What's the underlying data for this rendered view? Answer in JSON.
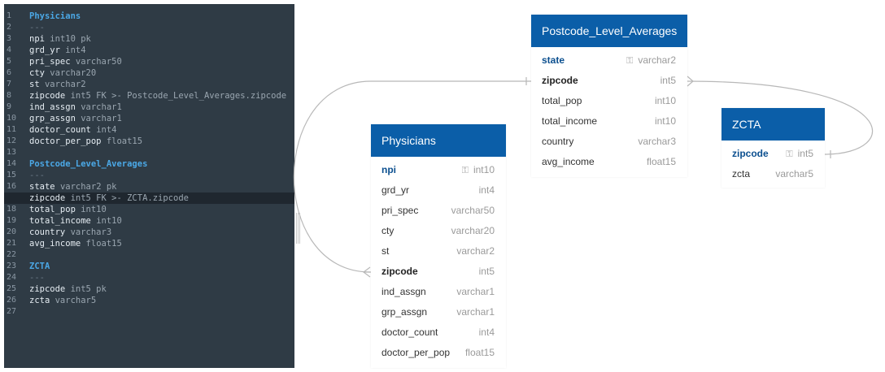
{
  "editor": {
    "lines": [
      {
        "n": "1",
        "parts": [
          {
            "t": "Physicians",
            "c": "tname"
          }
        ]
      },
      {
        "n": "2",
        "parts": [
          {
            "t": "---",
            "c": "sep"
          }
        ]
      },
      {
        "n": "3",
        "parts": [
          {
            "t": "npi ",
            "c": "col"
          },
          {
            "t": "int10 pk",
            "c": "meta"
          }
        ]
      },
      {
        "n": "4",
        "parts": [
          {
            "t": "grd_yr ",
            "c": "col"
          },
          {
            "t": "int4",
            "c": "meta"
          }
        ]
      },
      {
        "n": "5",
        "parts": [
          {
            "t": "pri_spec ",
            "c": "col"
          },
          {
            "t": "varchar50",
            "c": "meta"
          }
        ]
      },
      {
        "n": "6",
        "parts": [
          {
            "t": "cty ",
            "c": "col"
          },
          {
            "t": "varchar20",
            "c": "meta"
          }
        ]
      },
      {
        "n": "7",
        "parts": [
          {
            "t": "st ",
            "c": "col"
          },
          {
            "t": "varchar2",
            "c": "meta"
          }
        ]
      },
      {
        "n": "8",
        "parts": [
          {
            "t": "zipcode ",
            "c": "col"
          },
          {
            "t": "int5 FK >- Postcode_Level_Averages.zipcode",
            "c": "meta"
          }
        ]
      },
      {
        "n": "9",
        "parts": [
          {
            "t": "ind_assgn ",
            "c": "col"
          },
          {
            "t": "varchar1",
            "c": "meta"
          }
        ]
      },
      {
        "n": "10",
        "parts": [
          {
            "t": "grp_assgn ",
            "c": "col"
          },
          {
            "t": "varchar1",
            "c": "meta"
          }
        ]
      },
      {
        "n": "11",
        "parts": [
          {
            "t": "doctor_count ",
            "c": "col"
          },
          {
            "t": "int4",
            "c": "meta"
          }
        ]
      },
      {
        "n": "12",
        "parts": [
          {
            "t": "doctor_per_pop ",
            "c": "col"
          },
          {
            "t": "float15",
            "c": "meta"
          }
        ]
      },
      {
        "n": "13",
        "parts": []
      },
      {
        "n": "14",
        "parts": [
          {
            "t": "Postcode_Level_Averages",
            "c": "tname"
          }
        ]
      },
      {
        "n": "15",
        "parts": [
          {
            "t": "---",
            "c": "sep"
          }
        ]
      },
      {
        "n": "16",
        "parts": [
          {
            "t": "state ",
            "c": "col"
          },
          {
            "t": "varchar2 pk",
            "c": "meta"
          }
        ]
      },
      {
        "n": "17",
        "active": true,
        "parts": [
          {
            "t": "zipcode ",
            "c": "col"
          },
          {
            "t": "int5 FK >- ZCTA.zipcode",
            "c": "meta"
          }
        ]
      },
      {
        "n": "18",
        "parts": [
          {
            "t": "total_pop ",
            "c": "col"
          },
          {
            "t": "int10",
            "c": "meta"
          }
        ]
      },
      {
        "n": "19",
        "parts": [
          {
            "t": "total_income ",
            "c": "col"
          },
          {
            "t": "int10",
            "c": "meta"
          }
        ]
      },
      {
        "n": "20",
        "parts": [
          {
            "t": "country ",
            "c": "col"
          },
          {
            "t": "varchar3",
            "c": "meta"
          }
        ]
      },
      {
        "n": "21",
        "parts": [
          {
            "t": "avg_income ",
            "c": "col"
          },
          {
            "t": "float15",
            "c": "meta"
          }
        ]
      },
      {
        "n": "22",
        "parts": []
      },
      {
        "n": "23",
        "parts": [
          {
            "t": "ZCTA",
            "c": "tname"
          }
        ]
      },
      {
        "n": "24",
        "parts": [
          {
            "t": "---",
            "c": "sep"
          }
        ]
      },
      {
        "n": "25",
        "parts": [
          {
            "t": "zipcode ",
            "c": "col"
          },
          {
            "t": "int5 pk",
            "c": "meta"
          }
        ]
      },
      {
        "n": "26",
        "parts": [
          {
            "t": "zcta ",
            "c": "col"
          },
          {
            "t": "varchar5",
            "c": "meta"
          }
        ]
      },
      {
        "n": "27",
        "parts": []
      }
    ]
  },
  "diagram": {
    "colors": {
      "header_bg": "#0b5ea8",
      "header_text": "#ffffff",
      "link": "#b8b8b8",
      "editor_bg": "#2f3b45",
      "table_name_code": "#4ba8e6"
    },
    "tables": {
      "physicians": {
        "title": "Physicians",
        "fields": [
          {
            "name": "npi",
            "type": "int10",
            "pk": true
          },
          {
            "name": "grd_yr",
            "type": "int4"
          },
          {
            "name": "pri_spec",
            "type": "varchar50"
          },
          {
            "name": "cty",
            "type": "varchar20"
          },
          {
            "name": "st",
            "type": "varchar2"
          },
          {
            "name": "zipcode",
            "type": "int5",
            "fk": true
          },
          {
            "name": "ind_assgn",
            "type": "varchar1"
          },
          {
            "name": "grp_assgn",
            "type": "varchar1"
          },
          {
            "name": "doctor_count",
            "type": "int4"
          },
          {
            "name": "doctor_per_pop",
            "type": "float15"
          }
        ]
      },
      "postcode": {
        "title": "Postcode_Level_Averages",
        "fields": [
          {
            "name": "state",
            "type": "varchar2",
            "pk": true
          },
          {
            "name": "zipcode",
            "type": "int5",
            "fk": true
          },
          {
            "name": "total_pop",
            "type": "int10"
          },
          {
            "name": "total_income",
            "type": "int10"
          },
          {
            "name": "country",
            "type": "varchar3"
          },
          {
            "name": "avg_income",
            "type": "float15"
          }
        ]
      },
      "zcta": {
        "title": "ZCTA",
        "fields": [
          {
            "name": "zipcode",
            "type": "int5",
            "pk": true
          },
          {
            "name": "zcta",
            "type": "varchar5"
          }
        ]
      }
    }
  }
}
